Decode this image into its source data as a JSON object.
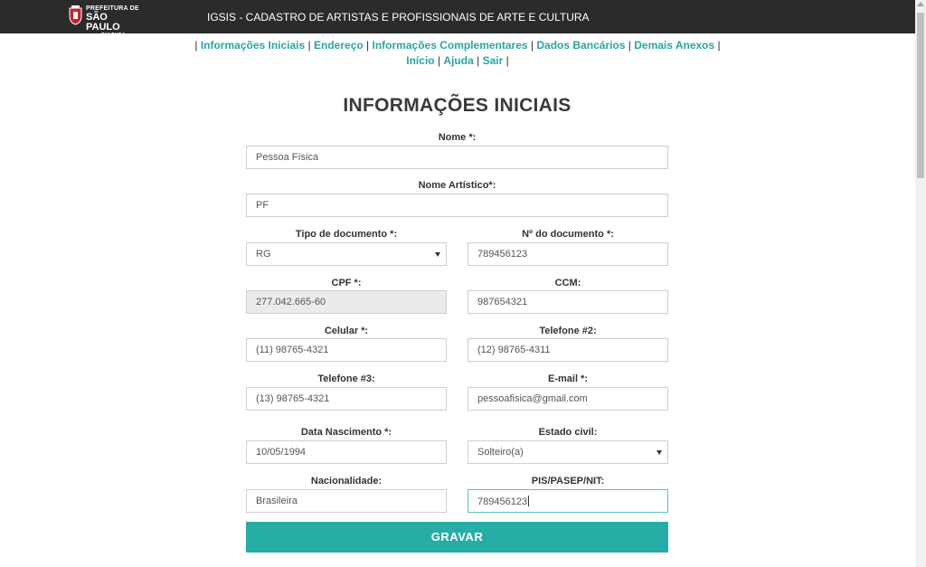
{
  "header": {
    "logo_line1": "PREFEITURA DE",
    "logo_line2": "SÃO PAULO",
    "logo_line3": "CULTURA",
    "title": "IGSIS - CADASTRO DE ARTISTAS E PROFISSIONAIS DE ARTE E CULTURA"
  },
  "nav": {
    "separator": "|",
    "items": [
      "Informações Iniciais",
      "Endereço",
      "Informações Complementares",
      "Dados Bancários",
      "Demais Anexos",
      "Início",
      "Ajuda",
      "Sair"
    ]
  },
  "page": {
    "title": "INFORMAÇÕES INICIAIS"
  },
  "form": {
    "nome": {
      "label": "Nome *:",
      "value": "Pessoa Física"
    },
    "nome_artistico": {
      "label": "Nome Artístico*:",
      "value": "PF"
    },
    "tipo_documento": {
      "label": "Tipo de documento *:",
      "value": "RG"
    },
    "num_documento": {
      "label": "Nº do documento *:",
      "value": "789456123"
    },
    "cpf": {
      "label": "CPF *:",
      "value": "277.042.665-60"
    },
    "ccm": {
      "label": "CCM:",
      "value": "987654321"
    },
    "celular": {
      "label": "Celular *:",
      "value": "(11) 98765-4321"
    },
    "telefone2": {
      "label": "Telefone #2:",
      "value": "(12) 98765-4311"
    },
    "telefone3": {
      "label": "Telefone #3:",
      "value": "(13) 98765-4321"
    },
    "email": {
      "label": "E-mail *:",
      "value": "pessoafisica@gmail.com"
    },
    "data_nascimento": {
      "label": "Data Nascimento *:",
      "value": "10/05/1994"
    },
    "estado_civil": {
      "label": "Estado civil:",
      "value": "Solteiro(a)"
    },
    "nacionalidade": {
      "label": "Nacionalidade:",
      "value": "Brasileira"
    },
    "pis": {
      "label": "PIS/PASEP/NIT:",
      "value": "789456123"
    },
    "submit_label": "GRAVAR"
  },
  "colors": {
    "accent": "#2aa5a0",
    "button": "#26aea6",
    "topbar": "#2b2b2b"
  }
}
